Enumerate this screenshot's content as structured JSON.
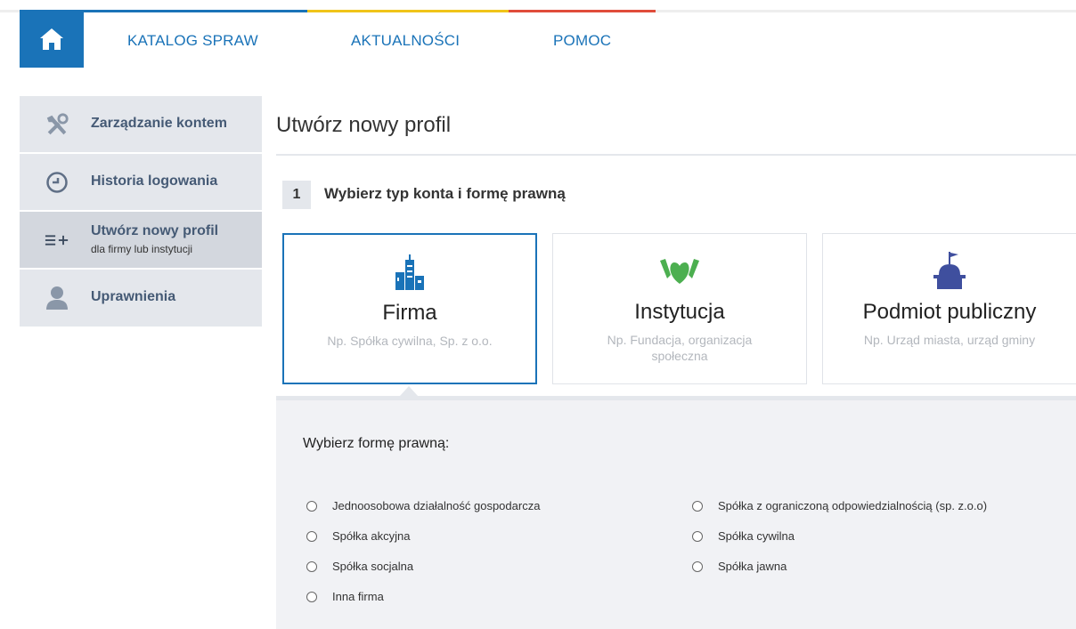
{
  "nav": {
    "home_icon": "home-icon",
    "links": [
      "KATALOG SPRAW",
      "AKTUALNOŚCI",
      "POMOC"
    ],
    "accent_colors": [
      "#1a73b8",
      "#f0c419",
      "#e04c3b"
    ]
  },
  "sidebar": {
    "items": [
      {
        "label": "Zarządzanie kontem",
        "icon": "tools-icon"
      },
      {
        "label": "Historia logowania",
        "icon": "clock-icon"
      },
      {
        "label": "Utwórz nowy profil",
        "sub": "dla firmy lub instytucji",
        "icon": "list-add-icon",
        "active": true
      },
      {
        "label": "Uprawnienia",
        "icon": "user-icon"
      }
    ]
  },
  "main": {
    "title": "Utwórz nowy profil",
    "step": {
      "number": "1",
      "title": "Wybierz typ konta i formę prawną"
    },
    "cards": [
      {
        "name": "Firma",
        "desc": "Np. Spółka cywilna, Sp. z o.o.",
        "icon": "buildings-icon",
        "selected": true
      },
      {
        "name": "Instytucja",
        "desc": "Np. Fundacja, organizacja społeczna",
        "icon": "hands-heart-icon"
      },
      {
        "name": "Podmiot publiczny",
        "desc": "Np. Urząd miasta, urząd gminy",
        "icon": "public-building-icon"
      }
    ],
    "legal_form": {
      "title": "Wybierz formę prawną:",
      "left": [
        "Jednoosobowa działalność gospodarcza",
        "Spółka akcyjna",
        "Spółka socjalna",
        "Inna firma"
      ],
      "right": [
        "Spółka z ograniczoną odpowiedzialnością (sp. z.o.o)",
        "Spółka cywilna",
        "Spółka jawna"
      ]
    }
  }
}
